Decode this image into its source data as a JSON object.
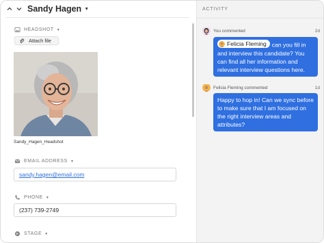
{
  "record": {
    "name": "Sandy Hagen"
  },
  "fields": {
    "headshot": {
      "label": "HEADSHOT",
      "attach_label": "Attach file",
      "caption": "Sandy_Hagen_Headshot"
    },
    "email": {
      "label": "EMAIL ADDRESS",
      "value": "sandy.hagen@email.com"
    },
    "phone": {
      "label": "PHONE",
      "value": "(237) 739-2749"
    },
    "stage": {
      "label": "STAGE"
    }
  },
  "activity": {
    "title": "ACTIVITY",
    "entries": [
      {
        "who": "You commented",
        "ago": "2d",
        "mention": "Felicia Fleming",
        "message_first": "can you fill in",
        "message_rest": "and interview this candidate? You can find all her information and relevant interview questions here."
      },
      {
        "who": "Felicia Fleming commented",
        "ago": "1d",
        "message": "Happy to hop in! Can we sync before to make sure that I am focused on the right interview areas and attributes?"
      }
    ]
  },
  "colors": {
    "accent": "#2f6fe0",
    "link": "#2f6fdc",
    "panel_bg": "#f3f3f3"
  },
  "icons": {
    "collapse": "chevron-up-icon",
    "expand": "chevron-down-icon",
    "headshot": "image-icon",
    "attach": "paperclip-icon",
    "email": "envelope-icon",
    "phone": "phone-icon",
    "stage": "stage-icon"
  }
}
